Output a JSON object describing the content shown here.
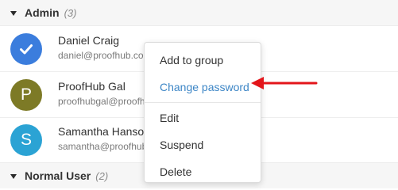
{
  "groups": [
    {
      "name": "Admin",
      "count": "(3)"
    },
    {
      "name": "Normal User",
      "count": "(2)"
    }
  ],
  "users": [
    {
      "name": "Daniel Craig",
      "email": "daniel@proofhub.com",
      "avatar_letter": "",
      "avatar_color": "#3b7ddd",
      "avatar_icon": "checkmark-icon"
    },
    {
      "name": "ProofHub Gal",
      "email": "proofhubgal@proofhub.com",
      "avatar_letter": "P",
      "avatar_color": "#7d7a26"
    },
    {
      "name": "Samantha Hanson",
      "email": "samantha@proofhub.com",
      "avatar_letter": "S",
      "avatar_color": "#2ba3d4"
    }
  ],
  "menu": {
    "items": [
      {
        "label": "Add to group"
      },
      {
        "label": "Change password",
        "highlighted": true
      },
      {
        "label": "Edit"
      },
      {
        "label": "Suspend"
      },
      {
        "label": "Delete"
      }
    ],
    "highlight_color": "#3d86c6"
  },
  "annotation": {
    "arrow_color": "#e3151a",
    "icon": "red-arrow-icon"
  }
}
